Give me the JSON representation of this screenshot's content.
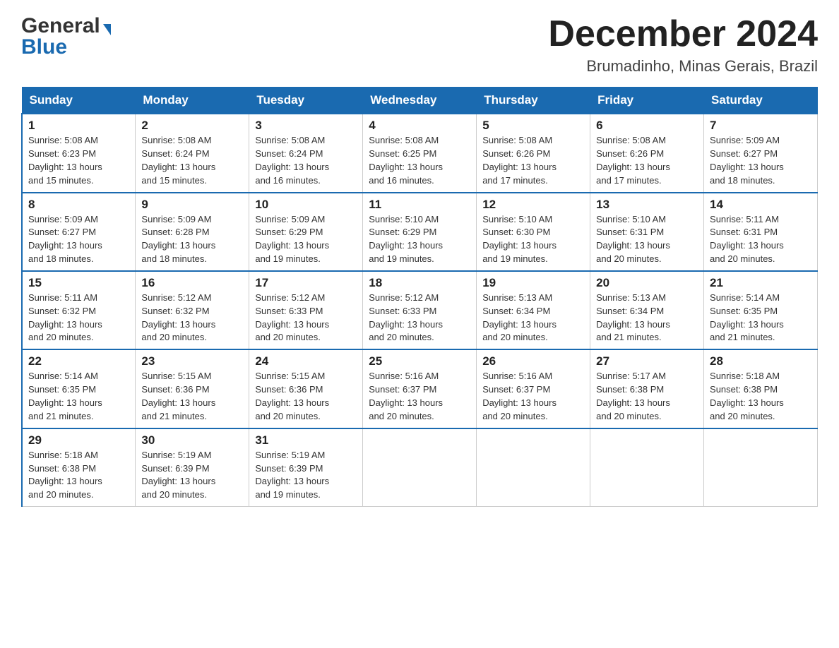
{
  "header": {
    "logo_general": "General",
    "logo_blue": "Blue",
    "month_title": "December 2024",
    "location": "Brumadinho, Minas Gerais, Brazil"
  },
  "columns": [
    "Sunday",
    "Monday",
    "Tuesday",
    "Wednesday",
    "Thursday",
    "Friday",
    "Saturday"
  ],
  "weeks": [
    [
      {
        "day": "1",
        "sunrise": "5:08 AM",
        "sunset": "6:23 PM",
        "daylight": "13 hours and 15 minutes."
      },
      {
        "day": "2",
        "sunrise": "5:08 AM",
        "sunset": "6:24 PM",
        "daylight": "13 hours and 15 minutes."
      },
      {
        "day": "3",
        "sunrise": "5:08 AM",
        "sunset": "6:24 PM",
        "daylight": "13 hours and 16 minutes."
      },
      {
        "day": "4",
        "sunrise": "5:08 AM",
        "sunset": "6:25 PM",
        "daylight": "13 hours and 16 minutes."
      },
      {
        "day": "5",
        "sunrise": "5:08 AM",
        "sunset": "6:26 PM",
        "daylight": "13 hours and 17 minutes."
      },
      {
        "day": "6",
        "sunrise": "5:08 AM",
        "sunset": "6:26 PM",
        "daylight": "13 hours and 17 minutes."
      },
      {
        "day": "7",
        "sunrise": "5:09 AM",
        "sunset": "6:27 PM",
        "daylight": "13 hours and 18 minutes."
      }
    ],
    [
      {
        "day": "8",
        "sunrise": "5:09 AM",
        "sunset": "6:27 PM",
        "daylight": "13 hours and 18 minutes."
      },
      {
        "day": "9",
        "sunrise": "5:09 AM",
        "sunset": "6:28 PM",
        "daylight": "13 hours and 18 minutes."
      },
      {
        "day": "10",
        "sunrise": "5:09 AM",
        "sunset": "6:29 PM",
        "daylight": "13 hours and 19 minutes."
      },
      {
        "day": "11",
        "sunrise": "5:10 AM",
        "sunset": "6:29 PM",
        "daylight": "13 hours and 19 minutes."
      },
      {
        "day": "12",
        "sunrise": "5:10 AM",
        "sunset": "6:30 PM",
        "daylight": "13 hours and 19 minutes."
      },
      {
        "day": "13",
        "sunrise": "5:10 AM",
        "sunset": "6:31 PM",
        "daylight": "13 hours and 20 minutes."
      },
      {
        "day": "14",
        "sunrise": "5:11 AM",
        "sunset": "6:31 PM",
        "daylight": "13 hours and 20 minutes."
      }
    ],
    [
      {
        "day": "15",
        "sunrise": "5:11 AM",
        "sunset": "6:32 PM",
        "daylight": "13 hours and 20 minutes."
      },
      {
        "day": "16",
        "sunrise": "5:12 AM",
        "sunset": "6:32 PM",
        "daylight": "13 hours and 20 minutes."
      },
      {
        "day": "17",
        "sunrise": "5:12 AM",
        "sunset": "6:33 PM",
        "daylight": "13 hours and 20 minutes."
      },
      {
        "day": "18",
        "sunrise": "5:12 AM",
        "sunset": "6:33 PM",
        "daylight": "13 hours and 20 minutes."
      },
      {
        "day": "19",
        "sunrise": "5:13 AM",
        "sunset": "6:34 PM",
        "daylight": "13 hours and 20 minutes."
      },
      {
        "day": "20",
        "sunrise": "5:13 AM",
        "sunset": "6:34 PM",
        "daylight": "13 hours and 21 minutes."
      },
      {
        "day": "21",
        "sunrise": "5:14 AM",
        "sunset": "6:35 PM",
        "daylight": "13 hours and 21 minutes."
      }
    ],
    [
      {
        "day": "22",
        "sunrise": "5:14 AM",
        "sunset": "6:35 PM",
        "daylight": "13 hours and 21 minutes."
      },
      {
        "day": "23",
        "sunrise": "5:15 AM",
        "sunset": "6:36 PM",
        "daylight": "13 hours and 21 minutes."
      },
      {
        "day": "24",
        "sunrise": "5:15 AM",
        "sunset": "6:36 PM",
        "daylight": "13 hours and 20 minutes."
      },
      {
        "day": "25",
        "sunrise": "5:16 AM",
        "sunset": "6:37 PM",
        "daylight": "13 hours and 20 minutes."
      },
      {
        "day": "26",
        "sunrise": "5:16 AM",
        "sunset": "6:37 PM",
        "daylight": "13 hours and 20 minutes."
      },
      {
        "day": "27",
        "sunrise": "5:17 AM",
        "sunset": "6:38 PM",
        "daylight": "13 hours and 20 minutes."
      },
      {
        "day": "28",
        "sunrise": "5:18 AM",
        "sunset": "6:38 PM",
        "daylight": "13 hours and 20 minutes."
      }
    ],
    [
      {
        "day": "29",
        "sunrise": "5:18 AM",
        "sunset": "6:38 PM",
        "daylight": "13 hours and 20 minutes."
      },
      {
        "day": "30",
        "sunrise": "5:19 AM",
        "sunset": "6:39 PM",
        "daylight": "13 hours and 20 minutes."
      },
      {
        "day": "31",
        "sunrise": "5:19 AM",
        "sunset": "6:39 PM",
        "daylight": "13 hours and 19 minutes."
      },
      null,
      null,
      null,
      null
    ]
  ],
  "labels": {
    "sunrise": "Sunrise:",
    "sunset": "Sunset:",
    "daylight": "Daylight:"
  }
}
